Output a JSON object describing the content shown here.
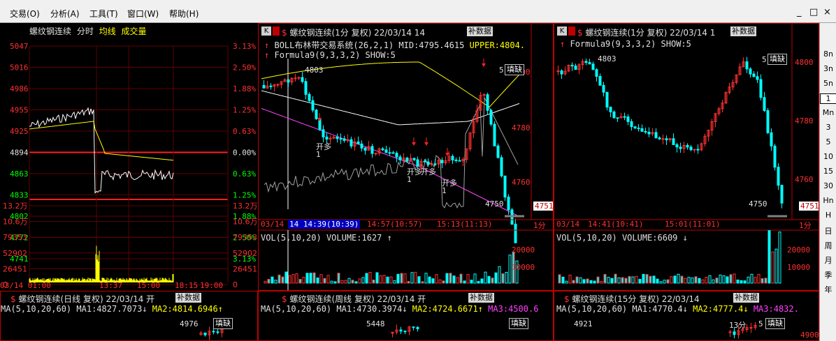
{
  "menu": {
    "items": [
      "交易(O)",
      "分析(A)",
      "工具(T)",
      "窗口(W)",
      "帮助(H)"
    ],
    "window_buttons": [
      "_",
      "□",
      "×"
    ]
  },
  "intraday": {
    "title": "螺纹钢连续",
    "tab_fenshi": "分时",
    "tab_junxian": "均线",
    "tab_volume": "成交量",
    "price_ticks": [
      "5047",
      "5016",
      "4986",
      "4955",
      "4925",
      "4894",
      "4863",
      "4833",
      "4802",
      "4772",
      "4741"
    ],
    "pct_ticks": [
      "3.13%",
      "2.50%",
      "1.88%",
      "1.25%",
      "0.63%",
      "0.00%",
      "0.63%",
      "1.25%",
      "1.88%",
      "2.50%",
      "3.13%"
    ],
    "vol_ticks": [
      "13.2万",
      "10.6万",
      "79353",
      "52902",
      "26451",
      "0"
    ],
    "time_labels": [
      "03/14 01:00",
      "13:37",
      "15:00",
      "18:15",
      "19:00"
    ]
  },
  "panel_1min_boll": {
    "title": "螺纹钢连续(1分  复权) 22/03/14 14",
    "k_label": "K",
    "bushu": "补数据",
    "ind1": "BOLL布林带交易系统(26,2,1)",
    "mid": "MID:4795.4615",
    "upper": "UPPER:4804.",
    "ind2": "Formula9(9,3,3,2)",
    "show": "SHOW:5",
    "price_ticks": [
      "4800",
      "4780",
      "4760"
    ],
    "high_label": "4803",
    "low_label": "4750",
    "last_price": "4751",
    "signals": [
      "开多",
      "开多",
      "开多",
      "开多"
    ],
    "signal_count": "1",
    "tianque": "填缺",
    "count_label": "5",
    "time_labels": [
      "03/14",
      "14 14:39(10:39)",
      "14:57(10:57)",
      "15:13(11:13)"
    ],
    "period": "1分",
    "vol_title": "VOL(5,10,20)",
    "vol_value": "VOLUME:1627",
    "vol_ticks": [
      "20000",
      "10000"
    ]
  },
  "panel_1min_right": {
    "title": "螺纹钢连续(1分  复权) 22/03/14 1",
    "k_label": "K",
    "bushu": "补数据",
    "ind2": "Formula9(9,3,3,2)",
    "show": "SHOW:5",
    "price_ticks": [
      "4800",
      "4780",
      "4760"
    ],
    "high_label": "4803",
    "low_label": "4750",
    "last_price": "4751",
    "tianque": "填缺",
    "count_label": "5",
    "time_labels": [
      "03/14",
      "14:41(10:41)",
      "15:01(11:01)"
    ],
    "period": "1分",
    "vol_title": "VOL(5,10,20)",
    "vol_value": "VOLUME:6609",
    "vol_ticks": [
      "20000",
      "10000"
    ]
  },
  "panel_daily": {
    "title": "螺纹钢连续(日线  复权) 22/03/14  开",
    "bushu": "补数据",
    "ma_label": "MA(5,10,20,60)",
    "ma1": "MA1:4827.7073",
    "ma2": "MA2:4814.6946",
    "high_label": "4976",
    "tianque": "填缺"
  },
  "panel_weekly": {
    "title": "螺纹钢连续(周线  复权) 22/03/14  开",
    "bushu": "补数据",
    "ma_label": "MA(5,10,20,60)",
    "ma1": "MA1:4730.3974",
    "ma2": "MA2:4724.6671",
    "ma3": "MA3:4500.6",
    "high_label": "5448",
    "tianque": "填缺"
  },
  "panel_15min": {
    "title": "螺纹钢连续(15分  复权) 22/03/14",
    "bushu": "补数据",
    "ma_label": "MA(5,10,20,60)",
    "ma1": "MA1:4770.4",
    "ma2": "MA2:4777.4",
    "ma3": "MA3:4832.",
    "high_label": "4921",
    "tianque": "填缺",
    "period_label": "13分",
    "count_label": "5",
    "price_tick": "4900"
  },
  "toolbar": {
    "items": [
      "8n",
      "3n",
      "5n",
      "1",
      "Mn",
      "3",
      "5",
      "10",
      "15",
      "30",
      "Hn",
      "H",
      "日",
      "周",
      "月",
      "季",
      "年"
    ]
  },
  "colors": {
    "up": "#ff3030",
    "down": "#00ffff",
    "ma_yellow": "#ffff00",
    "boll_mid": "#ffffff",
    "boll_lower": "#ff40ff",
    "intraday_price": "#ffffff"
  }
}
